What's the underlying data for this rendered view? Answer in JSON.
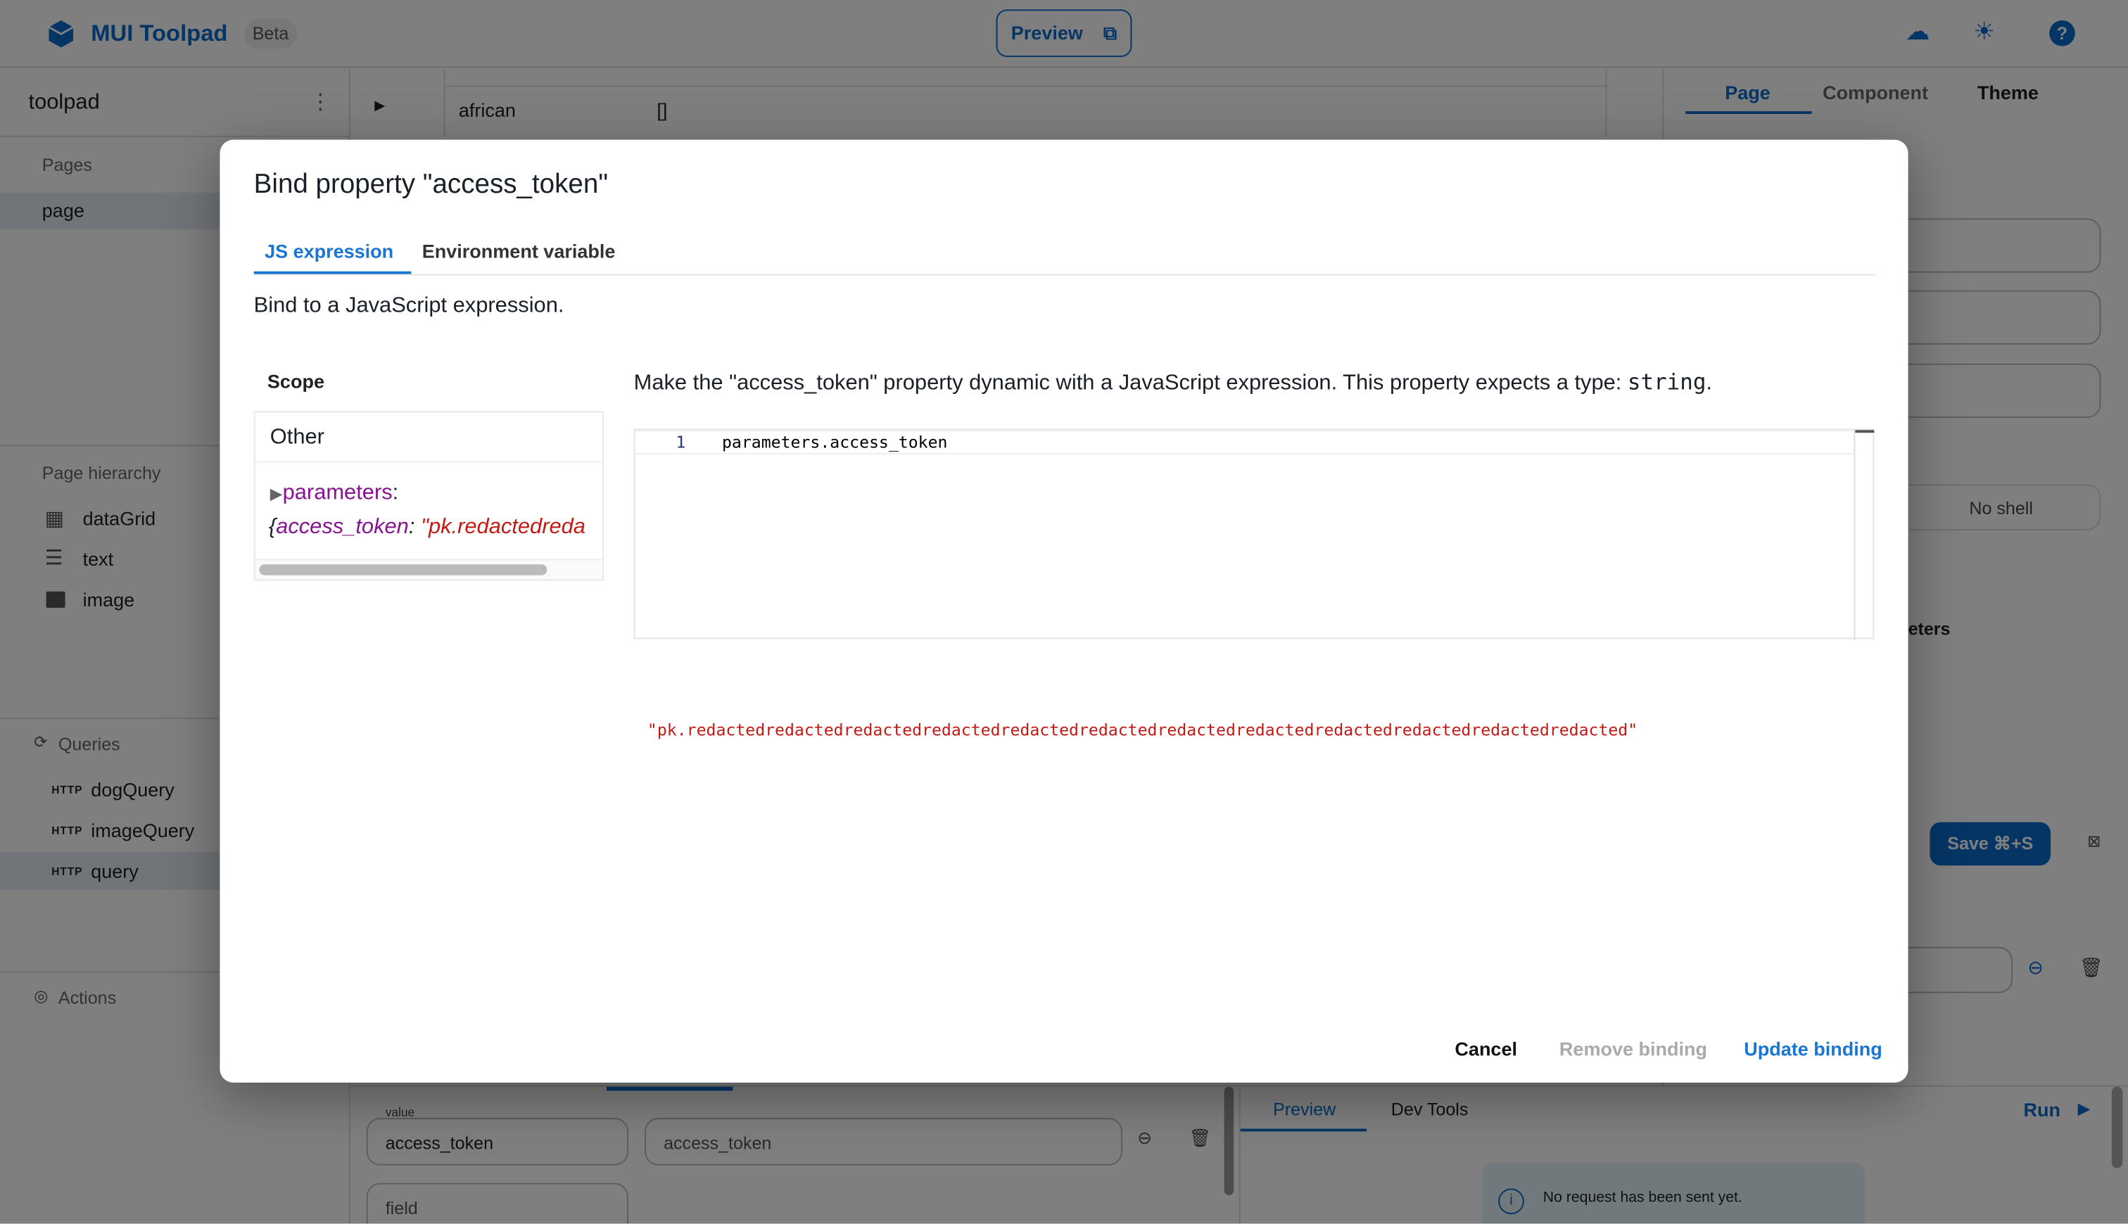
{
  "header": {
    "brand": "MUI Toolpad",
    "badge": "Beta",
    "preview_label": "Preview",
    "icons": [
      "cloud-check-icon",
      "sun-icon",
      "help-icon"
    ]
  },
  "sidebar": {
    "app_name": "toolpad",
    "pages_heading": "Pages",
    "pages": [
      {
        "label": "page",
        "selected": true
      }
    ],
    "hierarchy_heading": "Page hierarchy",
    "hierarchy": [
      {
        "label": "dataGrid",
        "icon": "grid-icon"
      },
      {
        "label": "text",
        "icon": "text-icon"
      },
      {
        "label": "image",
        "icon": "image-icon"
      }
    ],
    "queries_heading": "Queries",
    "queries": [
      {
        "type": "HTTP",
        "label": "dogQuery"
      },
      {
        "type": "HTTP",
        "label": "imageQuery"
      },
      {
        "type": "HTTP",
        "label": "query",
        "selected": true
      }
    ],
    "actions_heading": "Actions"
  },
  "canvas": {
    "row_key": "african",
    "row_value": "[]"
  },
  "right_panel": {
    "tabs": [
      "Page",
      "Component",
      "Theme"
    ],
    "active_tab": "Page",
    "shell_option": "No shell",
    "section_partial": "eters",
    "save_label": "Save ⌘+S"
  },
  "query_editor": {
    "value_label": "value",
    "param_name": "access_token",
    "param_value": "access_token",
    "field_placeholder": "field",
    "tabs": [
      "Preview",
      "Dev Tools"
    ],
    "run_label": "Run",
    "info_text": "No request has been sent yet."
  },
  "dialog": {
    "title": "Bind property \"access_token\"",
    "tabs": [
      "JS expression",
      "Environment variable"
    ],
    "active_tab": "JS expression",
    "subtitle": "Bind to a JavaScript expression.",
    "scope_heading": "Scope",
    "scope_group": "Other",
    "scope_key": "parameters",
    "scope_obj_key": "access_token",
    "scope_obj_value": "\"pk.redactedreda",
    "description_prefix": "Make the \"access_token\" property dynamic with a JavaScript expression. This property expects a type: ",
    "description_type": "string",
    "description_suffix": ".",
    "editor_line_number": "1",
    "editor_code": "parameters.access_token",
    "result": "\"pk.redactedredactedredactedredactedredactedredactedredactedredactedredactedredactedredactedredacted\"",
    "cancel_label": "Cancel",
    "remove_label": "Remove binding",
    "update_label": "Update binding"
  },
  "colors": {
    "accent": "#0b6bcb",
    "link": "#1976d2",
    "string": "#c41a16",
    "key": "#881391"
  }
}
